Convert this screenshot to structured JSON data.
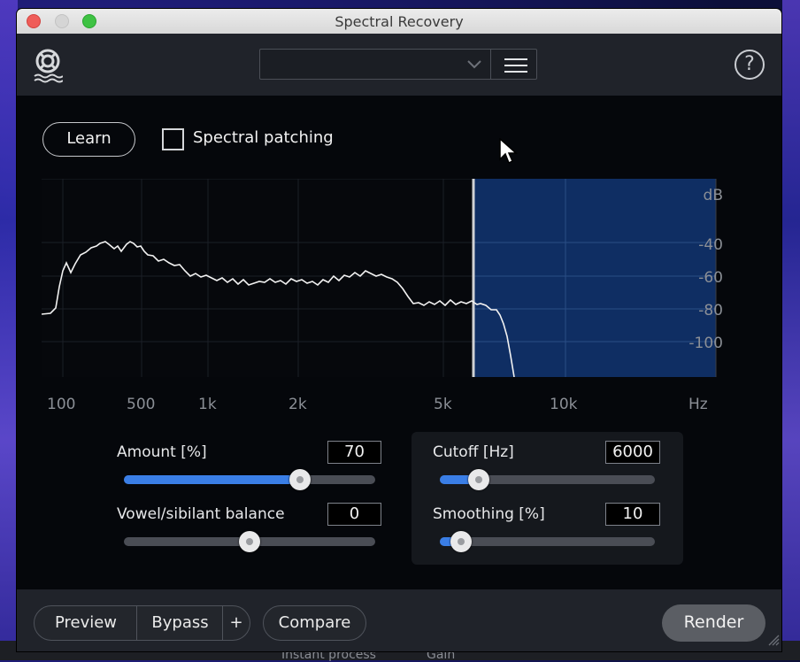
{
  "window": {
    "title": "Spectral Recovery"
  },
  "header": {
    "preset_value": "",
    "menu_icon": "hamburger-icon",
    "help_icon": "?"
  },
  "controls": {
    "learn_label": "Learn",
    "spectral_patching_label": "Spectral patching",
    "spectral_patching_checked": false
  },
  "spectrum": {
    "y_unit": "dB",
    "y_ticks": [
      "-40",
      "-60",
      "-80",
      "-100"
    ],
    "x_ticks": [
      "100",
      "500",
      "1k",
      "2k",
      "5k",
      "10k"
    ],
    "x_unit": "Hz",
    "cutoff_hz": 6000,
    "highlight_color": "#0f2e63"
  },
  "sliders": {
    "amount": {
      "label": "Amount [%]",
      "value": "70",
      "fraction": 0.7
    },
    "balance": {
      "label": "Vowel/sibilant balance",
      "value": "0",
      "fraction": 0.5
    },
    "cutoff": {
      "label": "Cutoff [Hz]",
      "value": "6000",
      "fraction": 0.18
    },
    "smoothing": {
      "label": "Smoothing [%]",
      "value": "10",
      "fraction": 0.1
    }
  },
  "footer": {
    "preview": "Preview",
    "bypass": "Bypass",
    "plus": "+",
    "compare": "Compare",
    "render": "Render"
  },
  "background_bar": {
    "instant_process": "Instant process",
    "gain": "Gain"
  },
  "colors": {
    "accent": "#3a7ee6",
    "panel": "#20232a",
    "window_bg": "#05070b"
  }
}
